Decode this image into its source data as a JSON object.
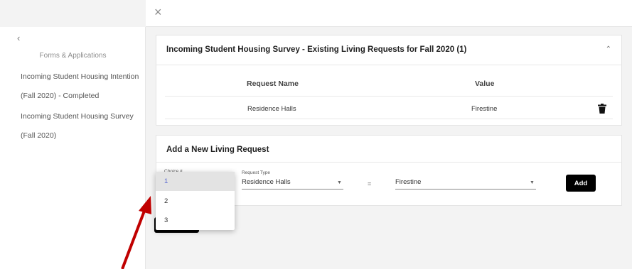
{
  "topbar": {
    "close_label": "×"
  },
  "sidebar": {
    "back_label": "‹",
    "title": "Forms & Applications",
    "items": [
      {
        "label": "Incoming Student Housing Intention"
      },
      {
        "label": "(Fall 2020) - Completed"
      },
      {
        "label": "Incoming Student Housing Survey"
      },
      {
        "label": "(Fall 2020)"
      }
    ]
  },
  "existing_card": {
    "title": "Incoming Student Housing Survey - Existing Living Requests for Fall 2020 (1)",
    "collapse_icon": "chevron-up-icon",
    "columns": [
      "Request Name",
      "Value"
    ],
    "rows": [
      {
        "name": "Residence Halls",
        "value": "Firestine"
      }
    ]
  },
  "new_card": {
    "title": "Add a New Living Request",
    "choice_label": "Choice #",
    "request_type_label": "Request Type",
    "request_type_value": "Residence Halls",
    "equals": "=",
    "value_value": "Firestine",
    "add_label": "Add"
  },
  "choice_dropdown": {
    "options": [
      "1",
      "2",
      "3"
    ],
    "selected": "1"
  },
  "colors": {
    "annotation_arrow": "#c00000",
    "button_bg": "#000000",
    "selected_option_text": "#5a6ad0"
  }
}
